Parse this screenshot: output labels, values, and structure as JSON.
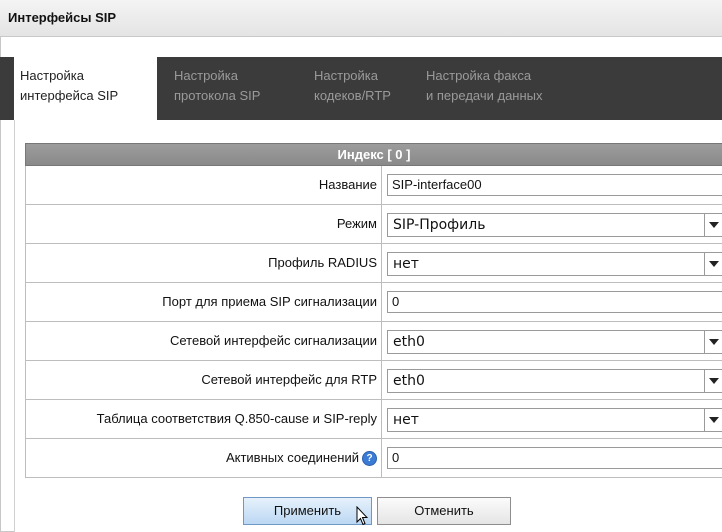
{
  "window": {
    "title": "Интерфейсы SIP"
  },
  "tabs": [
    {
      "line1": "Настройка",
      "line2": "интерфейса SIP",
      "active": true
    },
    {
      "line1": "Настройка",
      "line2": "протокола SIP",
      "active": false
    },
    {
      "line1": "Настройка",
      "line2": "кодеков/RTP",
      "active": false
    },
    {
      "line1": "Настройка факса",
      "line2": "и передачи данных",
      "active": false
    }
  ],
  "form": {
    "header": "Индекс [ 0 ]",
    "rows": [
      {
        "label": "Название",
        "type": "input",
        "value": "SIP-interface00"
      },
      {
        "label": "Режим",
        "type": "select",
        "value": "SIP-Профиль"
      },
      {
        "label": "Профиль RADIUS",
        "type": "select",
        "value": "нет"
      },
      {
        "label": "Порт для приема SIP сигнализации",
        "type": "input",
        "value": "0"
      },
      {
        "label": "Сетевой интерфейс сигнализации",
        "type": "select",
        "value": "eth0"
      },
      {
        "label": "Сетевой интерфейс для RTP",
        "type": "select",
        "value": "eth0"
      },
      {
        "label": "Таблица соответствия Q.850-cause и SIP-reply",
        "type": "select",
        "value": "нет"
      },
      {
        "label": "Активных соединений",
        "type": "input",
        "value": "0",
        "help_icon": "question-icon"
      }
    ]
  },
  "buttons": {
    "apply": "Применить",
    "cancel": "Отменить"
  },
  "colors": {
    "tabbar": "#3b3b3b",
    "header": "#8f8f8f",
    "help": "#3a7bd5"
  }
}
